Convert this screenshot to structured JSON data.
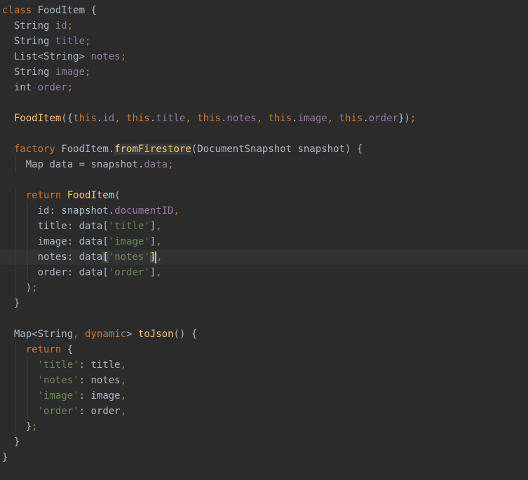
{
  "theme": {
    "background": "#2b2b2b",
    "current_line": "#323232",
    "keyword": "#cc7832",
    "function": "#ffc66d",
    "field": "#9876aa",
    "string": "#6a8759",
    "text": "#a9b7c6"
  },
  "code": {
    "language": "Dart",
    "current_line_index": 16,
    "lines": [
      "class FoodItem {",
      "  String id;",
      "  String title;",
      "  List<String> notes;",
      "  String image;",
      "  int order;",
      "",
      "  FoodItem({this.id, this.title, this.notes, this.image, this.order});",
      "",
      "  factory FoodItem.fromFirestore(DocumentSnapshot snapshot) {",
      "    Map data = snapshot.data;",
      "",
      "    return FoodItem(",
      "      id: snapshot.documentID,",
      "      title: data['title'],",
      "      image: data['image'],",
      "      notes: data['notes'],",
      "      order: data['order'],",
      "    );",
      "  }",
      "",
      "  Map<String, dynamic> toJson() {",
      "    return {",
      "      'title': title,",
      "      'notes': notes,",
      "      'image': image,",
      "      'order': order,",
      "    };",
      "  }",
      "}"
    ]
  }
}
